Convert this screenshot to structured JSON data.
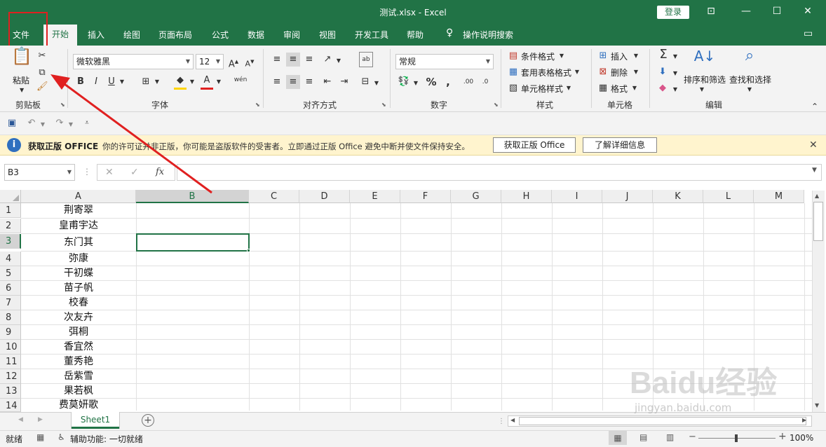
{
  "window": {
    "title": "测试.xlsx  -  Excel",
    "login_label": "登录",
    "controls": [
      "ribbon-display-icon",
      "minimize-icon",
      "maximize-icon",
      "close-icon"
    ]
  },
  "tabs": [
    {
      "label": "文件"
    },
    {
      "label": "开始"
    },
    {
      "label": "插入"
    },
    {
      "label": "绘图"
    },
    {
      "label": "页面布局"
    },
    {
      "label": "公式"
    },
    {
      "label": "数据"
    },
    {
      "label": "审阅"
    },
    {
      "label": "视图"
    },
    {
      "label": "开发工具"
    },
    {
      "label": "帮助"
    },
    {
      "label": "操作说明搜索"
    }
  ],
  "ribbon": {
    "clipboard": {
      "paste_label": "粘贴",
      "group_label": "剪贴板"
    },
    "font": {
      "font_name": "微软雅黑",
      "font_size": "12",
      "group_label": "字体",
      "bold": "B",
      "italic": "I",
      "underline": "U",
      "phonetic": "wén"
    },
    "alignment": {
      "group_label": "对齐方式"
    },
    "number": {
      "format": "常规",
      "group_label": "数字",
      "percent": "%",
      "comma": ","
    },
    "styles": {
      "conditional": "条件格式",
      "table": "套用表格格式",
      "cell_style": "单元格样式",
      "group_label": "样式"
    },
    "cells": {
      "insert": "插入",
      "delete": "删除",
      "format": "格式",
      "group_label": "单元格"
    },
    "editing": {
      "sort": "排序和筛选",
      "find": "查找和选择",
      "group_label": "编辑"
    }
  },
  "infobar": {
    "title": "获取正版 OFFICE",
    "message": "你的许可证并非正版，你可能是盗版软件的受害者。立即通过正版 Office 避免中断并使文件保持安全。",
    "btn_get": "获取正版 Office",
    "btn_learn": "了解详细信息"
  },
  "formula": {
    "name_box": "B3",
    "fx": "fx",
    "value": ""
  },
  "columns": [
    "A",
    "B",
    "C",
    "D",
    "E",
    "F",
    "G",
    "H",
    "I",
    "J",
    "K",
    "L",
    "M"
  ],
  "rows": [
    {
      "n": "1",
      "a": "荆寄翠"
    },
    {
      "n": "2",
      "a": "皇甫宇达"
    },
    {
      "n": "3",
      "a": "东门其"
    },
    {
      "n": "4",
      "a": "弥康"
    },
    {
      "n": "5",
      "a": "干初蝶"
    },
    {
      "n": "6",
      "a": "苗子帆"
    },
    {
      "n": "7",
      "a": "校春"
    },
    {
      "n": "8",
      "a": "次友卉"
    },
    {
      "n": "9",
      "a": "弭桐"
    },
    {
      "n": "10",
      "a": "香宜然"
    },
    {
      "n": "11",
      "a": "董秀艳"
    },
    {
      "n": "12",
      "a": "岳紫雪"
    },
    {
      "n": "13",
      "a": "果若枫"
    },
    {
      "n": "14",
      "a": "费莫妍歌"
    }
  ],
  "sheet": {
    "tab": "Sheet1"
  },
  "status": {
    "ready": "就绪",
    "accessibility": "辅助功能: 一切就绪",
    "zoom": "100%"
  },
  "watermark": {
    "brand": "Baidu经验",
    "url": "jingyan.baidu.com"
  },
  "colors": {
    "excel_green": "#217346",
    "annotation_red": "#e02020",
    "info_bg": "#fff4ce"
  }
}
